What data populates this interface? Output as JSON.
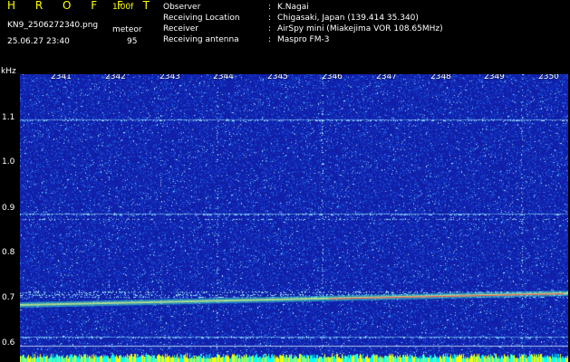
{
  "header": {
    "app_title": "H R O F F T",
    "version": "1.00f",
    "filename": "KN9_2506272340.png",
    "timestamp": "25.06.27 23:40",
    "meteor_label": "meteor",
    "meteor_count": "95"
  },
  "info": [
    {
      "label": "Observer",
      "value": "K.Nagai"
    },
    {
      "label": "Receiving Location",
      "value": "Chigasaki, Japan (139.414 35.340)"
    },
    {
      "label": "Receiver",
      "value": "AirSpy mini (Miakejima VOR 108.65MHz)"
    },
    {
      "label": "Receiving antenna",
      "value": "Maspro FM-3"
    }
  ],
  "info_separator": ":",
  "axes": {
    "y_unit": "kHz",
    "y_ticks": [
      "1.1",
      "1.0",
      "0.9",
      "0.8",
      "0.7",
      "0.6"
    ],
    "x_ticks": [
      "2341",
      "2342",
      "2343",
      "2344",
      "2345",
      "2346",
      "2347",
      "2348",
      "2349",
      "2350"
    ]
  },
  "colors": {
    "background": "#000000",
    "spectrum_base": "#101ea8",
    "title": "#ffff00",
    "signal_trace": "#ff5050",
    "bottom_strip": "#ffff00"
  }
}
